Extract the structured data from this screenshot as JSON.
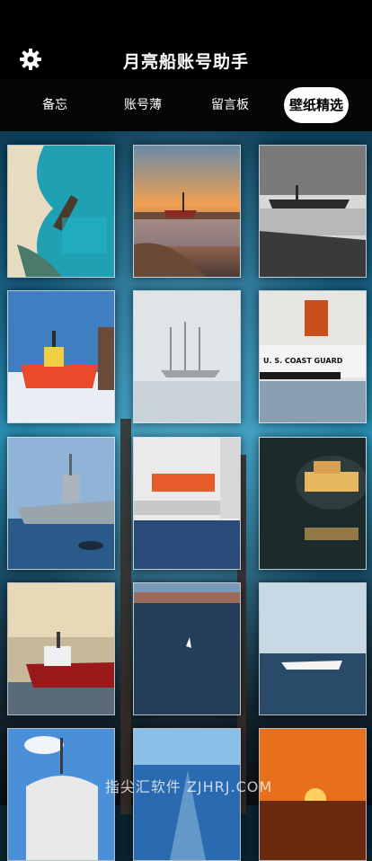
{
  "app": {
    "title": "月亮船账号助手"
  },
  "tabs": [
    {
      "label": "备忘"
    },
    {
      "label": "账号薄"
    },
    {
      "label": "留言板"
    },
    {
      "label": "壁纸精选",
      "active": true
    }
  ],
  "wallpapers": [
    {
      "subject": "shipwreck-lagoon"
    },
    {
      "subject": "ship-at-sunset-dock"
    },
    {
      "subject": "grey-ship-reflection"
    },
    {
      "subject": "orange-icebreaker"
    },
    {
      "subject": "tall-ship-in-fog"
    },
    {
      "subject": "coast-guard-cutter",
      "caption": "U. S.  COAST  GUARD"
    },
    {
      "subject": "grey-warship-harbor"
    },
    {
      "subject": "ship-lifeboat-closeup"
    },
    {
      "subject": "lit-ship-at-night"
    },
    {
      "subject": "red-tanker-harbor"
    },
    {
      "subject": "sailboat-fjord"
    },
    {
      "subject": "white-liner-at-sea"
    },
    {
      "subject": "cruise-ship-bow"
    },
    {
      "subject": "ship-wake-blue"
    },
    {
      "subject": "sunset-ocean"
    }
  ],
  "watermark": "指尖汇软件 ZJHRJ.COM",
  "colors": {
    "header": "#000000",
    "tab_active_bg": "#ffffff",
    "accent": "#1b6a8f"
  }
}
